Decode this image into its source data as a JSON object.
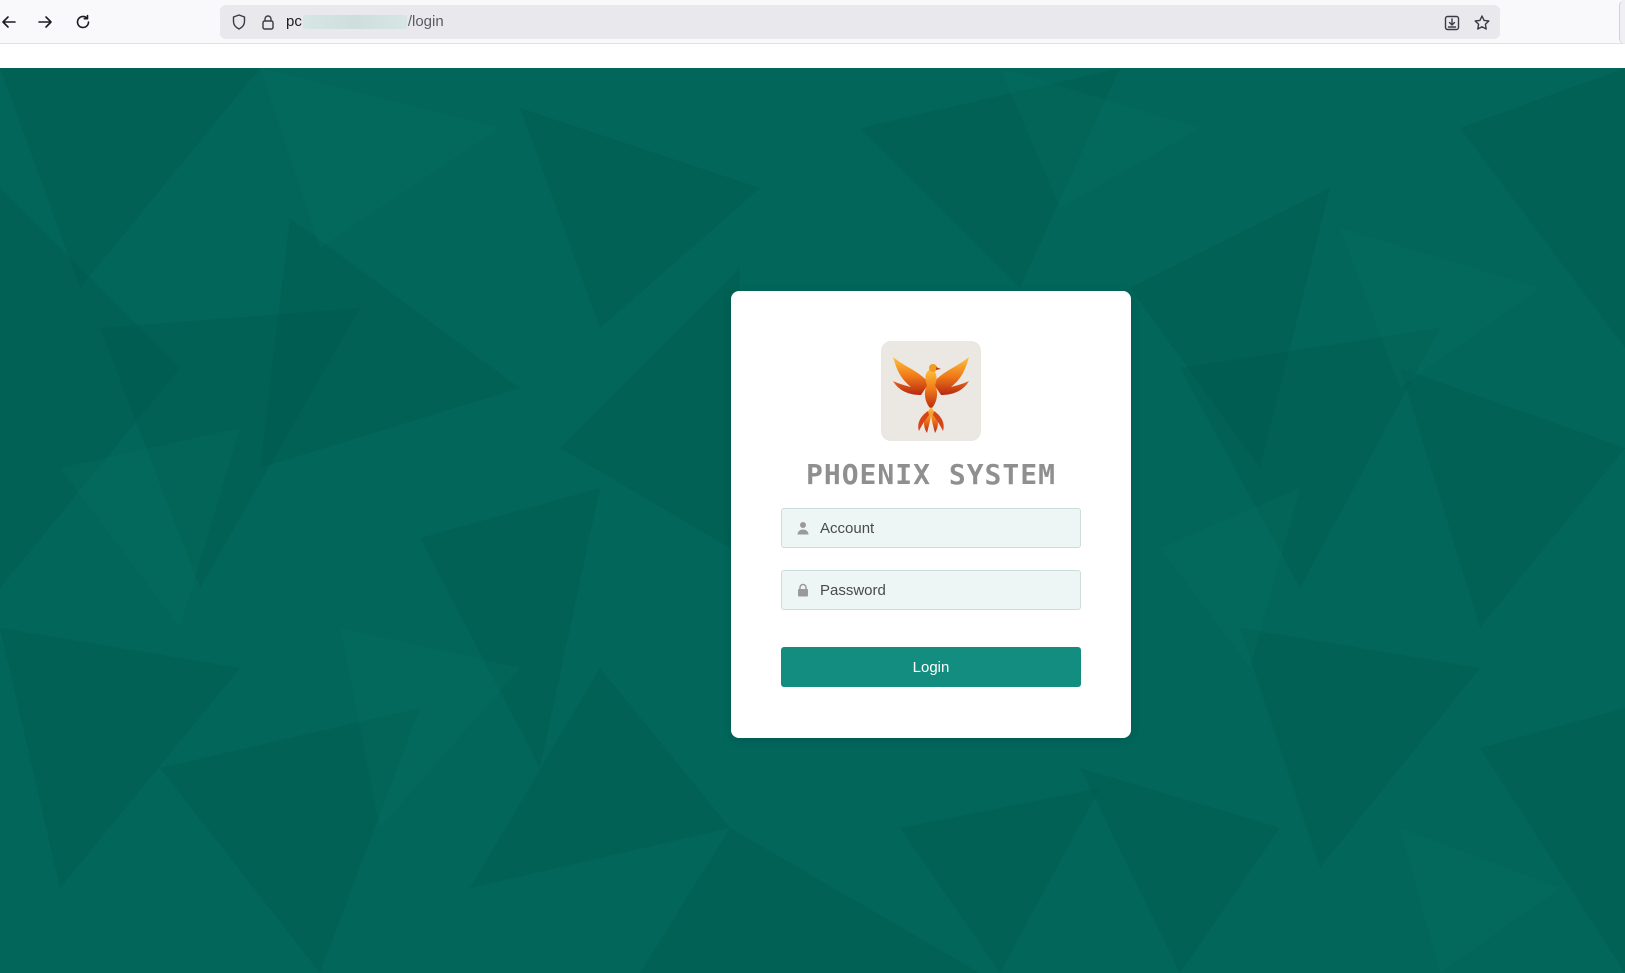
{
  "browser": {
    "url_host_visible": "pc",
    "url_path": "/login",
    "icons": {
      "back": "back-arrow-icon",
      "forward": "forward-arrow-icon",
      "reload": "reload-icon",
      "shield": "tracking-shield-icon",
      "lock": "lock-icon",
      "save": "save-to-device-icon",
      "bookmark": "bookmark-star-icon"
    }
  },
  "page": {
    "background_color": "#02665a"
  },
  "login": {
    "title": "PHOENIX SYSTEM",
    "logo": "phoenix-logo",
    "account": {
      "placeholder": "Account",
      "value": "",
      "icon": "user-icon"
    },
    "password": {
      "placeholder": "Password",
      "value": "",
      "icon": "lock-icon"
    },
    "button_label": "Login",
    "button_color": "#138d7f"
  }
}
